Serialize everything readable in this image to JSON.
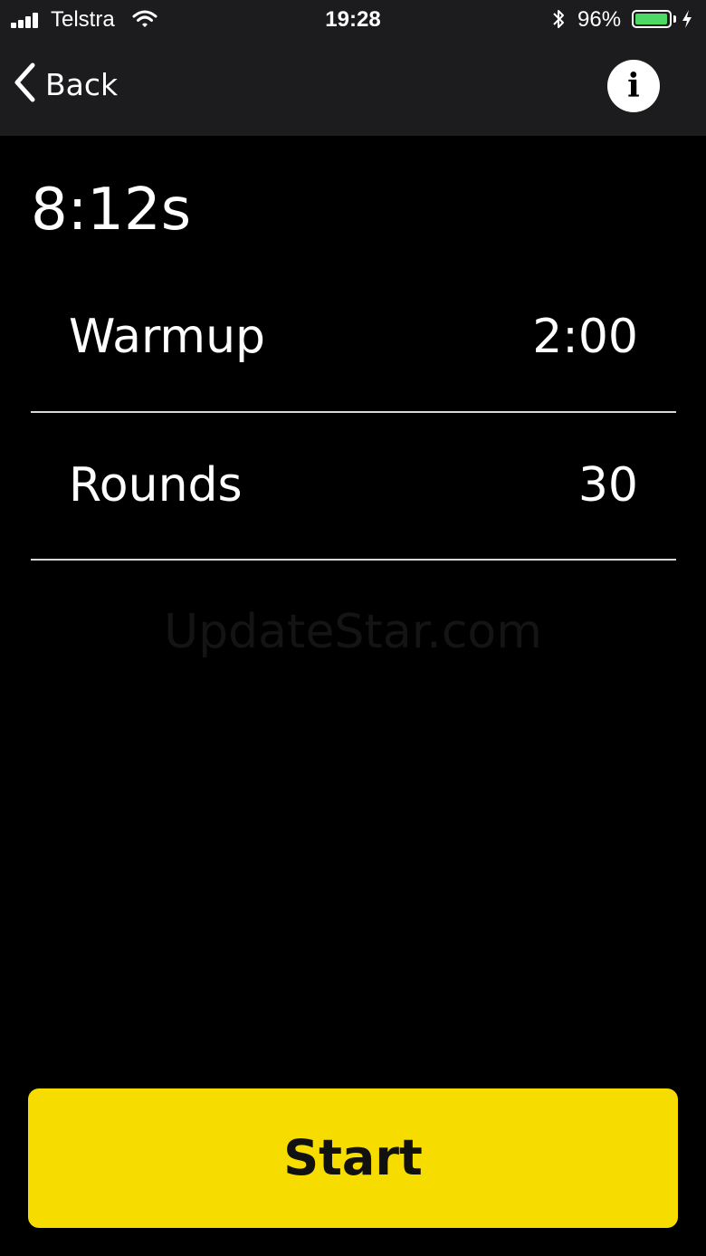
{
  "status_bar": {
    "carrier": "Telstra",
    "time": "19:28",
    "battery_percent": "96%",
    "battery_level": 0.96,
    "battery_color": "#4cd964"
  },
  "nav": {
    "back_label": "Back",
    "info_glyph": "i"
  },
  "workout": {
    "total_time": "8:12s",
    "settings": [
      {
        "label": "Warmup",
        "value": "2:00"
      },
      {
        "label": "Rounds",
        "value": "30"
      }
    ]
  },
  "watermark": "UpdateStar.com",
  "actions": {
    "start_label": "Start",
    "start_color": "#f7dc00"
  },
  "icons": [
    "signal-icon",
    "wifi-icon",
    "bluetooth-icon",
    "battery-icon",
    "charging-icon",
    "chevron-left-icon",
    "info-icon"
  ]
}
